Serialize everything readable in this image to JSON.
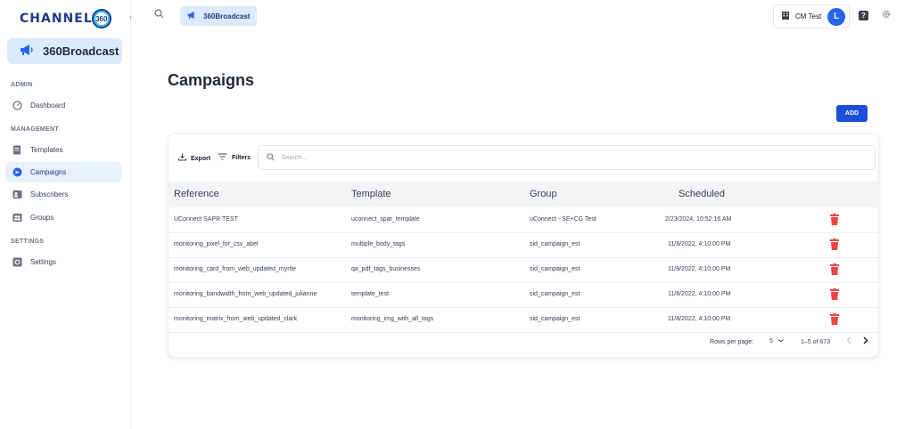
{
  "brand": {
    "logo_text": "CHANNEL",
    "logo_badge": "360",
    "product_name": "360Broadcast"
  },
  "sidebar": {
    "sections": [
      {
        "title": "ADMIN",
        "items": [
          {
            "label": "Dashboard",
            "icon": "dashboard-icon"
          }
        ]
      },
      {
        "title": "MANAGEMENT",
        "items": [
          {
            "label": "Templates",
            "icon": "templates-icon"
          },
          {
            "label": "Campaigns",
            "icon": "campaigns-icon",
            "active": true
          },
          {
            "label": "Subscribers",
            "icon": "subscribers-icon"
          },
          {
            "label": "Groups",
            "icon": "groups-icon"
          }
        ]
      },
      {
        "title": "SETTINGS",
        "items": [
          {
            "label": "Settings",
            "icon": "settings-icon"
          }
        ]
      }
    ],
    "collapse_glyph": "‹"
  },
  "topbar": {
    "chip_label": "360Broadcast",
    "user_name": "CM Test",
    "avatar_initial": "L",
    "help_glyph": "?"
  },
  "main": {
    "title": "Campaigns",
    "add_label": "ADD",
    "toolbar": {
      "export_label": "Export",
      "filters_label": "Filters",
      "search_placeholder": "Search..."
    },
    "table": {
      "columns": [
        "Reference",
        "Template",
        "Group",
        "Scheduled"
      ],
      "rows": [
        {
          "reference": "UConnect SAPR TEST",
          "template": "uconnect_spar_template",
          "group": "uConnect - SE+CG Test",
          "scheduled": "2/23/2024, 10:52:16 AM"
        },
        {
          "reference": "monitoring_pixel_for_csv_abel",
          "template": "multiple_body_tags",
          "group": "sid_campaign_est",
          "scheduled": "11/8/2022, 4:10:00 PM"
        },
        {
          "reference": "monitoring_card_from_web_updated_myrtle",
          "template": "qa_pdf_tags_businesses",
          "group": "sid_campaign_est",
          "scheduled": "11/8/2022, 4:10:00 PM"
        },
        {
          "reference": "monitoring_bandwidth_from_web_updated_julianne",
          "template": "template_test",
          "group": "sid_campaign_est",
          "scheduled": "11/8/2022, 4:10:00 PM"
        },
        {
          "reference": "monitoring_matrix_from_web_updated_clark",
          "template": "monitoring_img_with_all_tags",
          "group": "sid_campaign_est",
          "scheduled": "11/8/2022, 4:10:00 PM"
        }
      ]
    },
    "pagination": {
      "rows_per_page_label": "Rows per page:",
      "rows_per_page_value": "5",
      "range_label": "1–5 of 673"
    }
  },
  "colors": {
    "accent": "#1d4ed8",
    "active_nav_bg": "#e8f0fb",
    "brand_card_bg": "#dbeafe",
    "delete_red": "#ef4444"
  }
}
